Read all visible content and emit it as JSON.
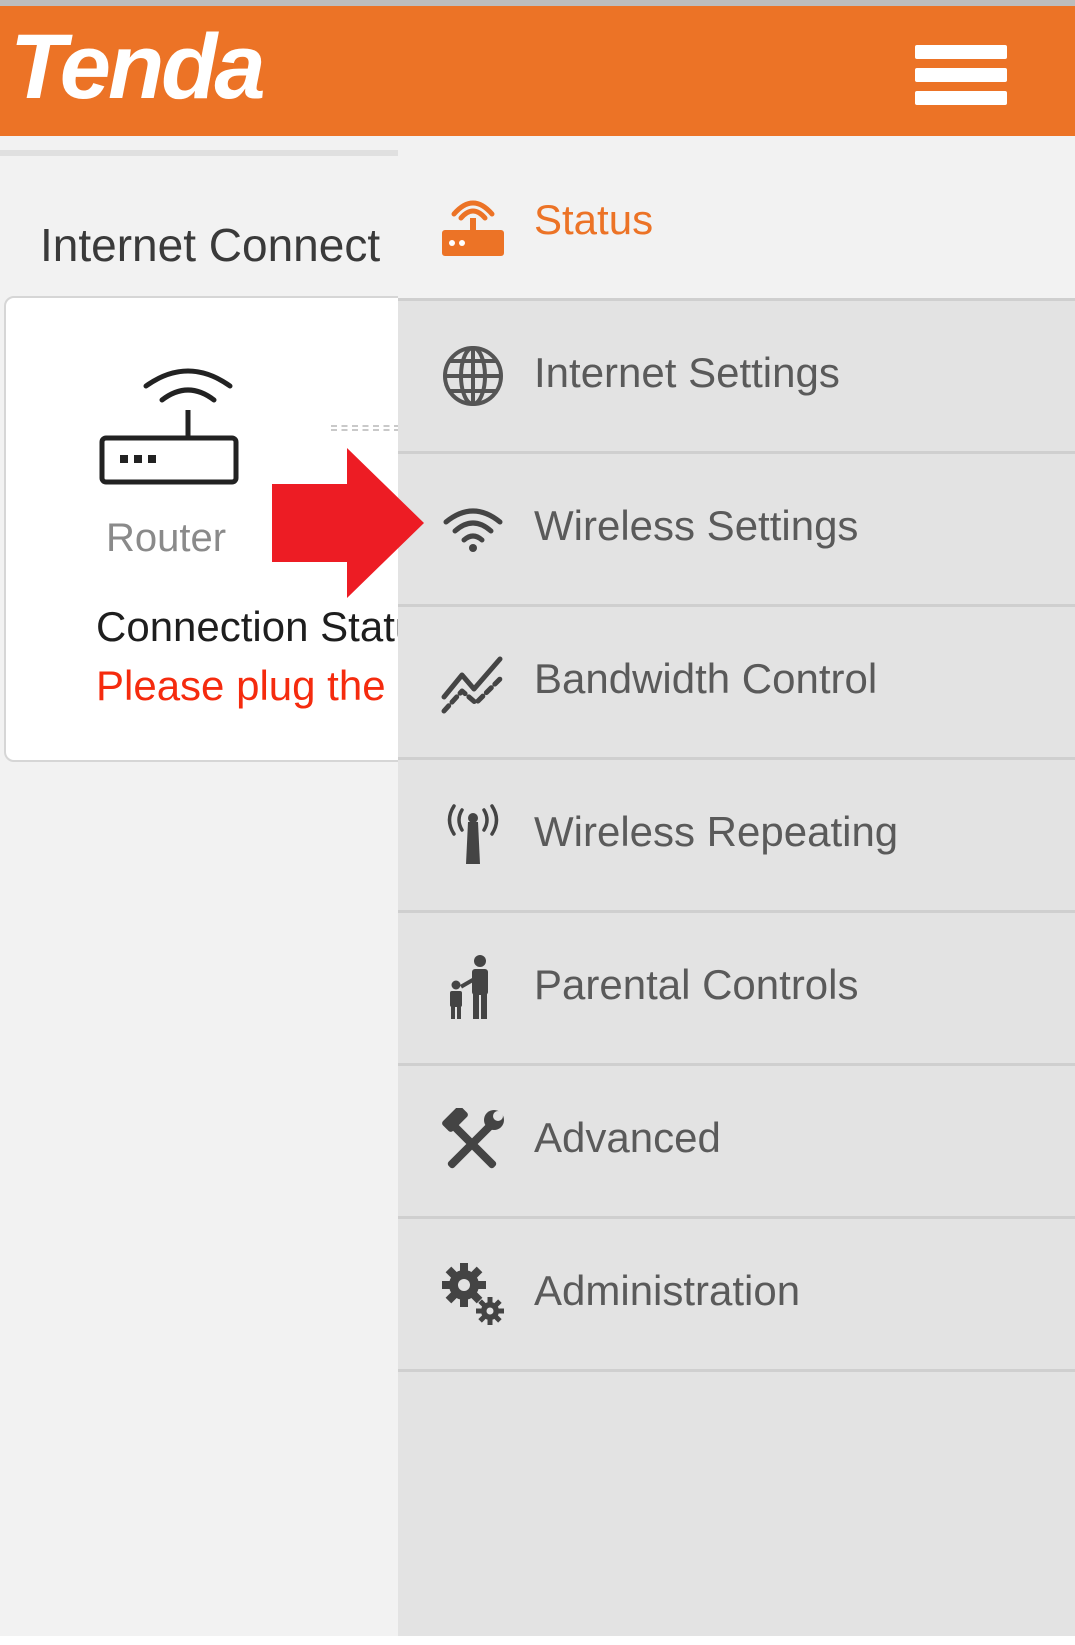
{
  "header": {
    "brand": "Tenda",
    "menu_icon": "hamburger-menu-icon",
    "brand_color": "#ec7326"
  },
  "page": {
    "title": "Internet Connect",
    "router_icon": "router-icon",
    "router_label": "Router",
    "connection_status_label": "Connection Statu",
    "connection_error": "Please plug the I",
    "error_color": "#f52b0e"
  },
  "menu": {
    "items": [
      {
        "label": "Status",
        "icon": "router-status-icon",
        "active": true
      },
      {
        "label": "Internet Settings",
        "icon": "globe-icon",
        "active": false
      },
      {
        "label": "Wireless Settings",
        "icon": "wifi-icon",
        "active": false
      },
      {
        "label": "Bandwidth Control",
        "icon": "bandwidth-chart-icon",
        "active": false
      },
      {
        "label": "Wireless Repeating",
        "icon": "antenna-icon",
        "active": false
      },
      {
        "label": "Parental Controls",
        "icon": "parent-child-icon",
        "active": false
      },
      {
        "label": "Advanced",
        "icon": "tools-icon",
        "active": false
      },
      {
        "label": "Administration",
        "icon": "gears-icon",
        "active": false
      }
    ]
  },
  "annotation": {
    "arrow_icon": "red-arrow-icon",
    "points_to": "Wireless Settings",
    "color": "#ed1c24"
  }
}
